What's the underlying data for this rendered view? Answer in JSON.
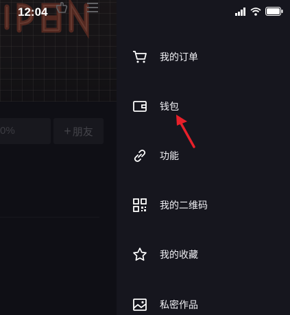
{
  "status_bar": {
    "time": "12:04",
    "icons": [
      "signal-icon",
      "wifi-icon",
      "battery-icon"
    ]
  },
  "profile": {
    "stat_partial": "0%",
    "add_friend": {
      "icon": "+",
      "label": "朋友"
    }
  },
  "drawer": {
    "items": [
      {
        "icon": "cart-icon",
        "label": "我的订单"
      },
      {
        "icon": "wallet-icon",
        "label": "钱包"
      },
      {
        "icon": "link-icon",
        "label": "功能"
      },
      {
        "icon": "qr-code-icon",
        "label": "我的二维码"
      },
      {
        "icon": "star-icon",
        "label": "我的收藏"
      },
      {
        "icon": "image-icon",
        "label": "私密作品"
      }
    ]
  },
  "annotation": {
    "color": "#e8202a",
    "target": "钱包"
  }
}
